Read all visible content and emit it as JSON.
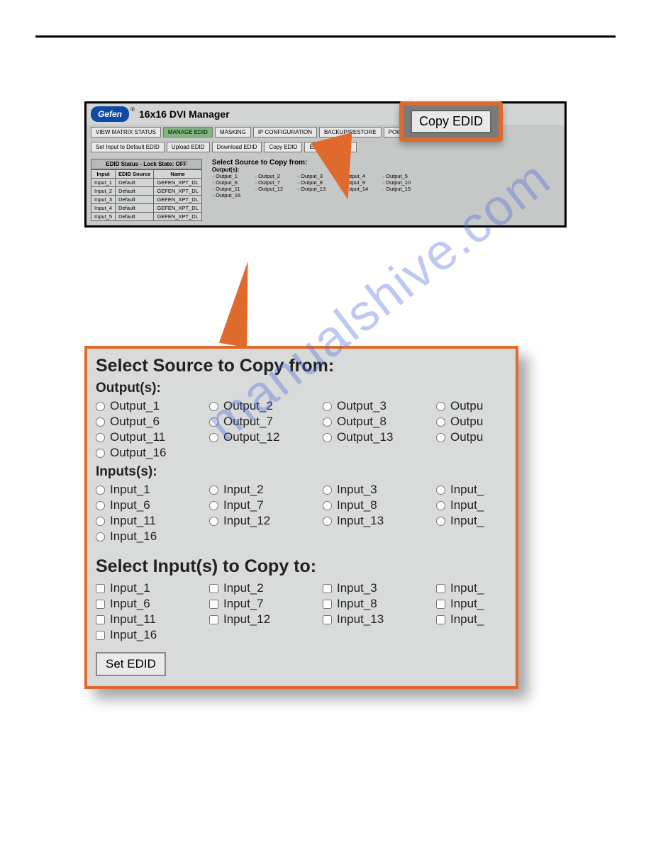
{
  "callout_button": "Copy EDID",
  "app": {
    "logo": "Gefen",
    "title": "16x16 DVI Manager",
    "tabs": [
      "VIEW MATRIX STATUS",
      "MANAGE EDID",
      "MASKING",
      "IP CONFIGURATION",
      "BACKUP/RESTORE",
      "POWER MANAGEMENT"
    ],
    "subtabs": [
      "Set Input to Default EDID",
      "Upload EDID",
      "Download EDID",
      "Copy EDID",
      "EDID Lock State"
    ],
    "table_caption": "EDID Status - Lock State: OFF",
    "table_headers": [
      "Input",
      "EDID Source",
      "Name"
    ],
    "table_rows": [
      [
        "Input_1",
        "Default",
        "GEFEN_XPT_DL"
      ],
      [
        "Input_2",
        "Default",
        "GEFEN_XPT_DL"
      ],
      [
        "Input_3",
        "Default",
        "GEFEN_XPT_DL"
      ],
      [
        "Input_4",
        "Default",
        "GEFEN_XPT_DL"
      ],
      [
        "Input_5",
        "Default",
        "GEFEN_XPT_DL"
      ]
    ],
    "mini_title": "Select Source to Copy from:",
    "mini_sub": "Output(s):",
    "mini_outputs": [
      "Output_1",
      "Output_2",
      "Output_3",
      "Output_4",
      "Output_5",
      "Output_6",
      "Output_7",
      "Output_8",
      "Output_9",
      "Output_10",
      "Output_11",
      "Output_12",
      "Output_13",
      "Output_14",
      "Output_15",
      "Output_16"
    ]
  },
  "zoom": {
    "heading1": "Select Source to Copy from:",
    "sub_outputs": "Output(s):",
    "outputs": [
      "Output_1",
      "Output_2",
      "Output_3",
      "Outpu",
      "Output_6",
      "Output_7",
      "Output_8",
      "Outpu",
      "Output_11",
      "Output_12",
      "Output_13",
      "Outpu",
      "Output_16"
    ],
    "sub_inputs": "Inputs(s):",
    "inputs": [
      "Input_1",
      "Input_2",
      "Input_3",
      "Input_",
      "Input_6",
      "Input_7",
      "Input_8",
      "Input_",
      "Input_11",
      "Input_12",
      "Input_13",
      "Input_",
      "Input_16"
    ],
    "heading2": "Select Input(s) to Copy to:",
    "copyto": [
      "Input_1",
      "Input_2",
      "Input_3",
      "Input_",
      "Input_6",
      "Input_7",
      "Input_8",
      "Input_",
      "Input_11",
      "Input_12",
      "Input_13",
      "Input_",
      "Input_16"
    ],
    "set_button": "Set EDID"
  },
  "watermark": "manualshive.com"
}
